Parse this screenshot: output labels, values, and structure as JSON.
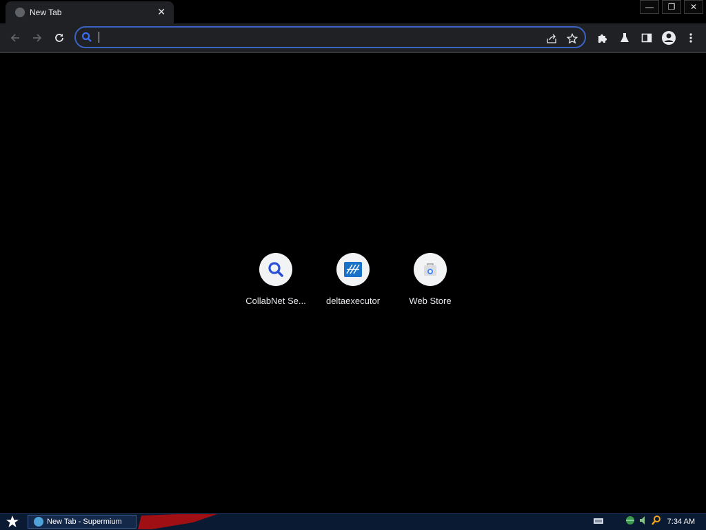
{
  "browser": {
    "tab": {
      "title": "New Tab",
      "close_glyph": "✕",
      "favicon": "globe-icon"
    },
    "window_controls": {
      "minimize": "—",
      "restore": "❐",
      "close": "✕"
    }
  },
  "toolbar": {
    "back": "arrow-left-icon",
    "forward": "arrow-right-icon",
    "reload": "reload-icon",
    "omnibox": {
      "value": "",
      "placeholder": ""
    },
    "share": "share-icon",
    "bookmark": "star-icon",
    "extensions": "puzzle-icon",
    "labs": "flask-icon",
    "side_panel": "side-panel-icon",
    "profile": "profile-icon",
    "menu": "kebab-menu-icon"
  },
  "shortcuts": [
    {
      "label": "CollabNet Se...",
      "icon": "search-icon"
    },
    {
      "label": "deltaexecutor",
      "icon": "deltaexecutor-icon"
    },
    {
      "label": "Web Store",
      "icon": "webstore-icon"
    }
  ],
  "taskbar": {
    "start": "start-star-icon",
    "task": {
      "label": "New Tab - Supermium",
      "icon": "supermium-icon"
    },
    "tray": {
      "keyboard": "keyboard-icon",
      "network": "network-icon",
      "audio": "audio-icon",
      "search": "search-icon"
    },
    "clock": "7:34 AM"
  },
  "colors": {
    "accent": "#3b63c4",
    "toolbar_bg": "#202124",
    "page_bg": "#000000",
    "taskbar_bg": "#0b1a33"
  }
}
